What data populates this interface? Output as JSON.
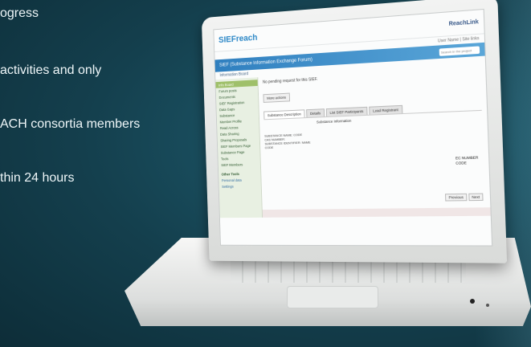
{
  "slide": {
    "bullets": [
      "ogress",
      "activities and only",
      "ACH consortia members",
      "thin 24 hours"
    ]
  },
  "site": {
    "logo": "SIEFreach",
    "brand_right": "ReachLink",
    "user_line": "User Name | Site links",
    "banner_title": "SIEF (Substance Information Exchange Forum)",
    "search_placeholder": "Search in the project",
    "breadcrumb": "Information Board"
  },
  "sidebar": {
    "items": [
      "Info Board",
      "Forum posts",
      "Documents",
      "SIEF Registration",
      "Data Gaps",
      "Substance",
      "Member Profile",
      "Read Across",
      "Data Sharing",
      "Sharing Proposals",
      "SIEF Members Page",
      "Substance Page",
      "Tools",
      "SIEF Members"
    ],
    "section_label": "Other Tools",
    "sub_items": [
      "Personal data",
      "Settings"
    ]
  },
  "main": {
    "message": "No pending request for this SIEF.",
    "action_button": "More actions",
    "tabs": [
      "Substance Description",
      "Details",
      "List SIEF Participants",
      "Lead Registrant"
    ],
    "subheading": "Substance Information",
    "info_lines": [
      "SUBSTANCE NAME:  CODE",
      "CAS NUMBER:",
      "SUBSTANCE IDENTIFIER: NAME",
      "CODE"
    ],
    "reference": [
      "EC NUMBER",
      "CODE"
    ],
    "pager": [
      "Previous",
      "Next"
    ]
  },
  "colors": {
    "background": "#143f4d",
    "banner": "#2f7fbf",
    "sidebar_active": "#9fc06a"
  }
}
